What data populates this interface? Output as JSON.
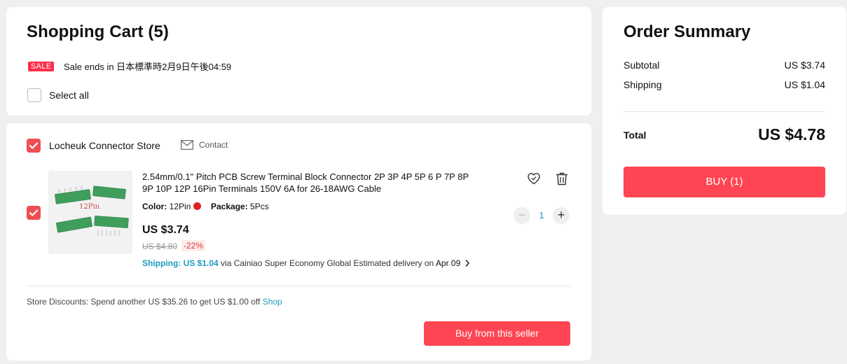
{
  "cart": {
    "title": "Shopping Cart (5)",
    "sale_badge": "SALE",
    "sale_text": "Sale ends in 日本標準時2月9日午後04:59",
    "select_all_label": "Select all",
    "select_all_checked": false
  },
  "store": {
    "name": "Locheuk Connector Store",
    "checked": true,
    "contact_label": "Contact",
    "item": {
      "checked": true,
      "image_text": "12Pin",
      "title": "2.54mm/0.1\" Pitch PCB Screw Terminal Block Connector 2P 3P 4P 5P 6 P 7P 8P 9P 10P 12P 16Pin Terminals 150V 6A for 26-18AWG Cable",
      "color_label": "Color:",
      "color_value": "12Pin",
      "color_swatch": "#e02020",
      "package_label": "Package:",
      "package_value": "5Pcs",
      "price": "US $3.74",
      "old_price": "US $4.80",
      "discount": "-22%",
      "shipping_label": "Shipping: US $1.04",
      "shipping_via": "via Cainiao Super Economy Global",
      "delivery_label": "Estimated delivery on",
      "delivery_date": "Apr 09",
      "quantity": "1",
      "minus": "−",
      "plus": "+"
    },
    "discount_label": "Store Discounts:",
    "discount_text": "Spend another US $35.26 to get US $1.00 off",
    "shop_link": "Shop",
    "buy_from_seller": "Buy from this seller"
  },
  "summary": {
    "title": "Order Summary",
    "subtotal_label": "Subtotal",
    "subtotal_value": "US $3.74",
    "shipping_label": "Shipping",
    "shipping_value": "US $1.04",
    "total_label": "Total",
    "total_value": "US $4.78",
    "buy_button": "BUY (1)"
  },
  "colors": {
    "accent": "#ff4553",
    "checkbox": "#ee4e52",
    "link": "#1c9bbf",
    "sale": "#ff2e49"
  },
  "icons": [
    "checkmark-icon",
    "mail-icon",
    "wishlist-heart-icon",
    "trash-icon",
    "chevron-right-icon"
  ]
}
